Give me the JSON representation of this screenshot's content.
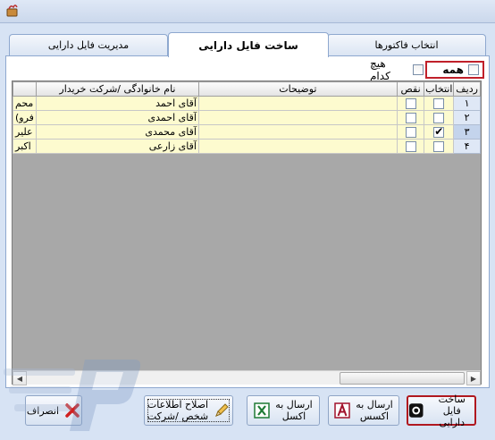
{
  "tabs": [
    {
      "label": "انتخاب فاکتورها",
      "active": false
    },
    {
      "label": "ساخت فایل دارایی",
      "active": true
    },
    {
      "label": "مدیریت فایل دارایی",
      "active": false
    }
  ],
  "options": {
    "all_label": "همه",
    "none_label": "هیچ کدام"
  },
  "grid": {
    "columns": {
      "row": "ردیف",
      "select": "انتخاب",
      "deficit": "نقص",
      "description": "توضیحات",
      "family_name": "نام خانوادگی /شرکت خریدار"
    },
    "rows": [
      {
        "row": "1",
        "row_label": "۱",
        "select": false,
        "deficit": false,
        "description": "",
        "family_name": "آقای احمد",
        "overflow": "محم"
      },
      {
        "row": "2",
        "row_label": "۲",
        "select": false,
        "deficit": false,
        "description": "",
        "family_name": "آقای احمدی",
        "overflow": "(فرو"
      },
      {
        "row": "3",
        "row_label": "۳",
        "select": true,
        "deficit": false,
        "description": "",
        "family_name": "آقای محمدی",
        "overflow": "علیر"
      },
      {
        "row": "4",
        "row_label": "۴",
        "select": false,
        "deficit": false,
        "description": "",
        "family_name": "آقای زارعی",
        "overflow": "اکبر"
      }
    ]
  },
  "buttons": {
    "cancel": "انصراف",
    "fix_info_line1": "اصلاح اطلاعات",
    "fix_info_line2": "شخص /شرکت",
    "send_excel_line1": "ارسال به",
    "send_excel_line2": "اکسل",
    "send_access_line1": "ارسال به",
    "send_access_line2": "اکسس",
    "build_line1": "ساخت",
    "build_line2": "فایل دارایی"
  },
  "colors": {
    "row_bg": "#fdfbcf",
    "grid_bg": "#a8a8a8",
    "highlight": "#c0202a",
    "panel": "#d7e3f4"
  }
}
